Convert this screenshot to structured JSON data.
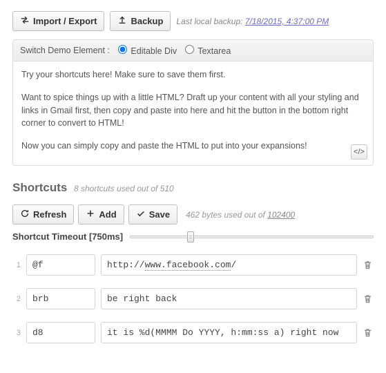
{
  "top": {
    "import_export_label": "Import / Export",
    "backup_label": "Backup",
    "backup_prefix": "Last local backup: ",
    "backup_time": "7/18/2015, 4:37:00 PM"
  },
  "demo_panel": {
    "switch_label": "Switch Demo Element :",
    "option_editable": "Editable Div",
    "option_textarea": "Textarea",
    "selected": "editable",
    "p1": "Try your shortcuts here! Make sure to save them first.",
    "p2": "Want to spice things up with a little HTML? Draft up your content with all your styling and links in Gmail first, then copy and paste into here and hit the button in the bottom right corner to convert to HTML!",
    "p3": "Now you can simply copy and paste the HTML to put into your expansions!",
    "code_btn": "</>"
  },
  "shortcuts": {
    "title": "Shortcuts",
    "summary": "8 shortcuts used out of 510",
    "refresh_label": "Refresh",
    "add_label": "Add",
    "save_label": "Save",
    "bytes_used": "462 bytes used out of ",
    "bytes_total": "102400",
    "timeout_label": "Shortcut Timeout [750ms]",
    "timeout_ms": 750,
    "timeout_min": 0,
    "timeout_max": 3000,
    "items": [
      {
        "n": "1",
        "key": "@f",
        "val_prefix": "http://",
        "val_mid": "www.facebook.com",
        "val_suffix": "/"
      },
      {
        "n": "2",
        "key": "brb",
        "val": "be right back"
      },
      {
        "n": "3",
        "key": "d8",
        "val": "it is %d(MMMM Do YYYY, h:mm:ss a) right now"
      }
    ]
  }
}
